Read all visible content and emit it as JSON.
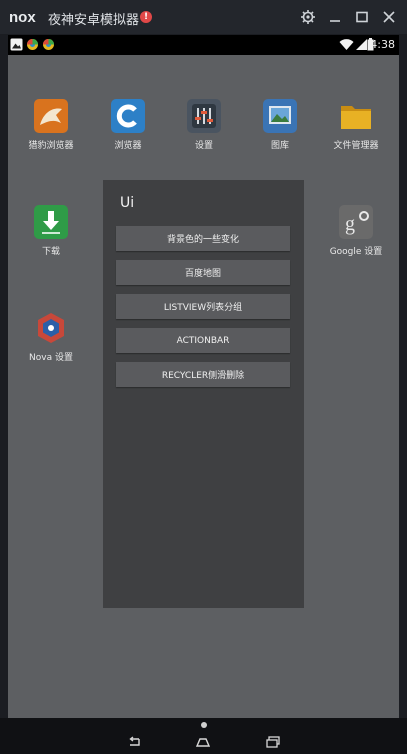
{
  "window": {
    "logo": "nox",
    "title": "夜神安卓模拟器",
    "alert_badge": "!",
    "controls": [
      "gear-icon",
      "minimize-icon",
      "maximize-icon",
      "close-icon"
    ]
  },
  "statusbar": {
    "left_icons": [
      "gallery-notification-icon",
      "app-notification-icon",
      "app-notification-icon"
    ],
    "time": "4:38"
  },
  "home_apps": [
    {
      "label": "猎豹浏览器",
      "icon": "cheetah-browser-icon",
      "color": "#d9731e"
    },
    {
      "label": "浏览器",
      "icon": "browser-icon",
      "color": "#2d80c7"
    },
    {
      "label": "设置",
      "icon": "settings-sliders-icon",
      "color": "#4a5460"
    },
    {
      "label": "图库",
      "icon": "gallery-icon",
      "color": "#3a74b5"
    },
    {
      "label": "文件管理器",
      "icon": "folder-icon",
      "color": "#e8b124"
    },
    {
      "label": "下载",
      "icon": "download-icon",
      "color": "#2f9b47"
    },
    {
      "label": "Google 设置",
      "icon": "google-settings-icon",
      "color": "#6a6a6a"
    },
    {
      "label": "Nova 设置",
      "icon": "nova-settings-icon",
      "color": "#c8483a"
    }
  ],
  "dialog": {
    "title": "Ui",
    "buttons": [
      "背景色的一些变化",
      "百度地图",
      "LISTVIEW列表分组",
      "ACTIONBAR",
      "RECYCLER侧滑删除"
    ]
  },
  "navbar": {
    "buttons": [
      "back-icon",
      "home-icon",
      "recent-apps-icon"
    ]
  }
}
